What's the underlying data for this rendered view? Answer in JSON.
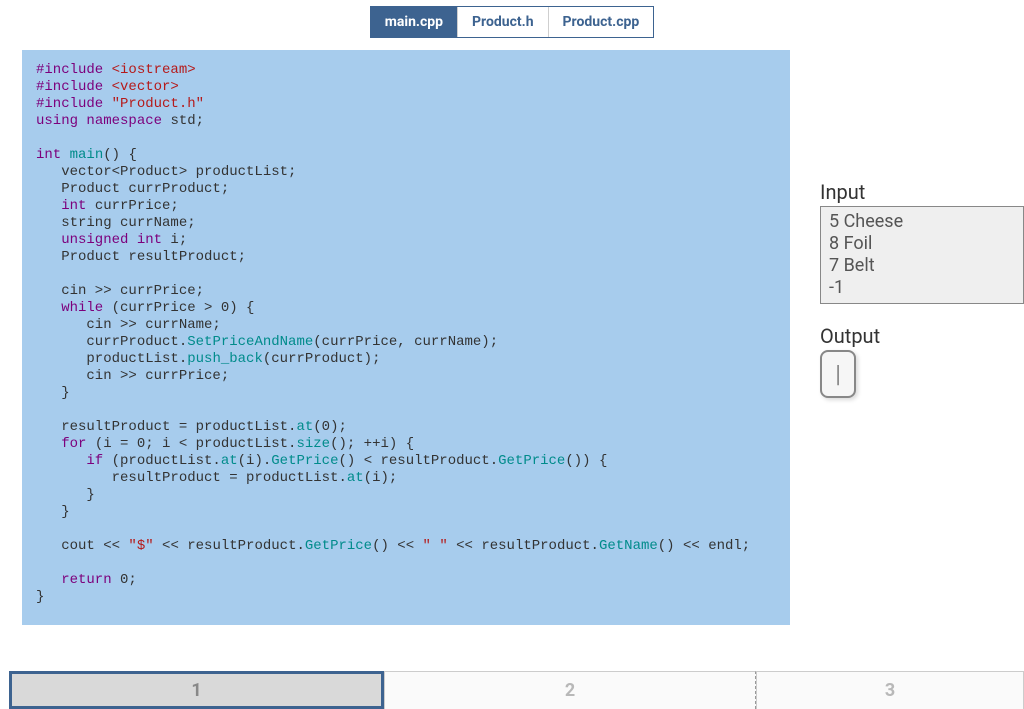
{
  "tabs": [
    "main.cpp",
    "Product.h",
    "Product.cpp"
  ],
  "active_tab_index": 0,
  "code": {
    "l1_kw": "#include",
    "l1_h": "<iostream>",
    "l2_kw": "#include",
    "l2_h": "<vector>",
    "l3_kw": "#include",
    "l3_h": "\"Product.h\"",
    "l4_kw1": "using",
    "l4_kw2": "namespace",
    "l4_std": "std;",
    "l6_kw": "int",
    "l6_fn": "main",
    "l6_tail": "() {",
    "l7": "   vector<Product> productList;",
    "l8": "   Product currProduct;",
    "l9_kw": "   int",
    "l9_id": " currPrice;",
    "l10": "   string currName;",
    "l11_kw": "   unsigned int",
    "l11_id": " i;",
    "l12": "   Product resultProduct;",
    "l14": "   cin >> currPrice;",
    "l15_kw": "   while",
    "l15_rest": " (currPrice > 0) {",
    "l16": "      cin >> currName;",
    "l17a": "      currProduct.",
    "l17_fn": "SetPriceAndName",
    "l17b": "(currPrice, currName);",
    "l18a": "      productList.",
    "l18_fn": "push_back",
    "l18b": "(currProduct);",
    "l19": "      cin >> currPrice;",
    "l20": "   }",
    "l22a": "   resultProduct = productList.",
    "l22_fn": "at",
    "l22b": "(0);",
    "l23_kw": "   for",
    "l23a": " (i = 0; i < productList.",
    "l23_fn": "size",
    "l23b": "(); ++i) {",
    "l24_kw": "      if",
    "l24a": " (productList.",
    "l24_fn1": "at",
    "l24b": "(i).",
    "l24_fn2": "GetPrice",
    "l24c": "() < resultProduct.",
    "l24_fn3": "GetPrice",
    "l24d": "()) {",
    "l25a": "         resultProduct = productList.",
    "l25_fn": "at",
    "l25b": "(i);",
    "l26": "      }",
    "l27": "   }",
    "l29a": "   cout << ",
    "l29_s1": "\"$\"",
    "l29b": " << resultProduct.",
    "l29_fn1": "GetPrice",
    "l29c": "() << ",
    "l29_s2": "\" \"",
    "l29d": " << resultProduct.",
    "l29_fn2": "GetName",
    "l29e": "() << endl;",
    "l31_kw": "   return",
    "l31_v": " 0;",
    "l32": "}"
  },
  "io": {
    "input_label": "Input",
    "output_label": "Output",
    "input_text": "5 Cheese\n8 Foil\n7 Belt\n-1"
  },
  "pager": [
    "1",
    "2",
    "3"
  ],
  "active_page_index": 0
}
